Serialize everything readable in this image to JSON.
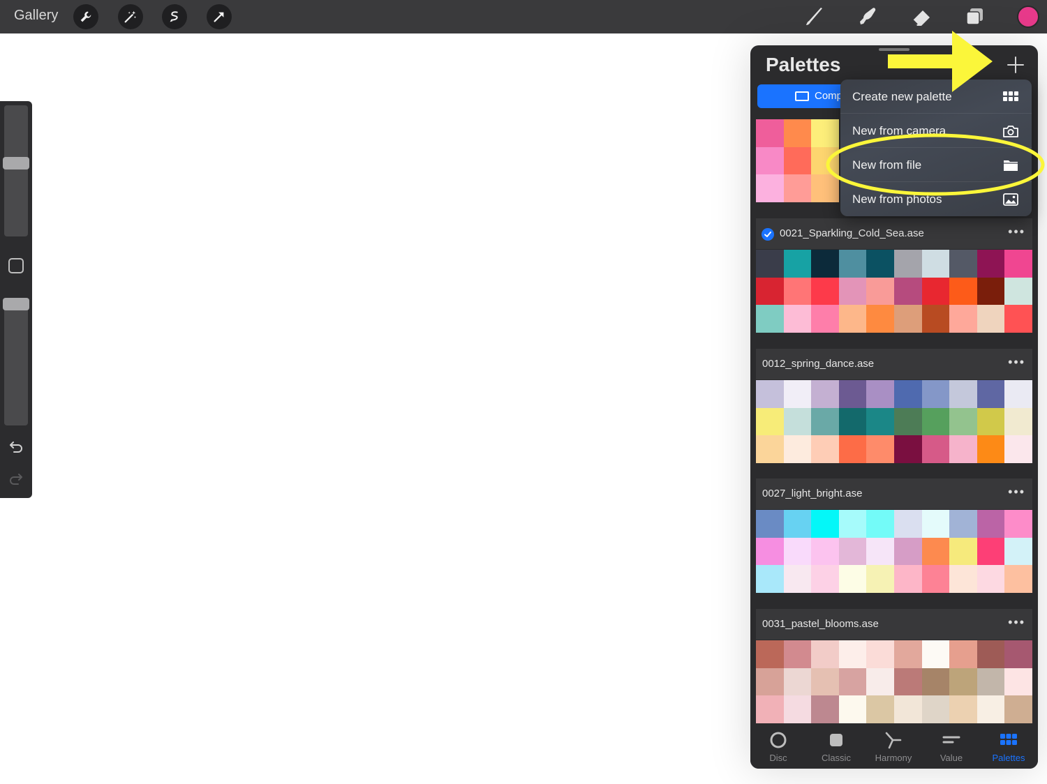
{
  "topbar": {
    "gallery_label": "Gallery",
    "left_tools": [
      "wrench-icon",
      "magic-wand-icon",
      "selection-icon",
      "transform-arrow-icon"
    ],
    "right_tools": [
      "brush-icon",
      "smudge-icon",
      "eraser-icon",
      "layers-icon"
    ],
    "current_color": "#e83a8b"
  },
  "panel": {
    "title": "Palettes",
    "view_tab_label": "Comp",
    "default_palette_colors": [
      "#ef5e9b",
      "#ff8a4c",
      "#fdee7a",
      "#f889c6",
      "#ff6b5a",
      "#fdd56f",
      "#fcb1df",
      "#ff9c97",
      "#ffc07a"
    ],
    "palettes": [
      {
        "name": "0021_Sparkling_Cold_Sea.ase",
        "selected": true,
        "colors": [
          "#3a3d4a",
          "#17a2a4",
          "#0c2a3a",
          "#4f8fa0",
          "#0b5162",
          "#a4a4ab",
          "#cfdde3",
          "#545966",
          "#8e1454",
          "#f04691",
          "#d82431",
          "#ff7576",
          "#fd3a4a",
          "#e394b8",
          "#f99b98",
          "#b64b7e",
          "#e82730",
          "#fd5b19",
          "#7a1e0b",
          "#cfe5df",
          "#7fccc2",
          "#fdbcd6",
          "#fe7eaa",
          "#fdb78a",
          "#fe8a40",
          "#dd9e7a",
          "#b84b22",
          "#fea89a",
          "#efd4be",
          "#ff5254"
        ]
      },
      {
        "name": "0012_spring_dance.ase",
        "selected": false,
        "colors": [
          "#c5c0db",
          "#f1eef7",
          "#c4b0d2",
          "#6c5a92",
          "#a98fc4",
          "#4f6aaf",
          "#8497c8",
          "#c4c8db",
          "#5f67a3",
          "#eaeaf3",
          "#f7ec78",
          "#c5dfdb",
          "#6aa9a7",
          "#13696b",
          "#1b8787",
          "#4d7c56",
          "#56a05d",
          "#93c38e",
          "#d1c94a",
          "#f1ead0",
          "#fbd59a",
          "#fdebde",
          "#fecdb6",
          "#fd6c47",
          "#fe8b6a",
          "#7a0f40",
          "#d65a88",
          "#f6b3cb",
          "#fd8a16",
          "#fbe7ec"
        ]
      },
      {
        "name": "0027_light_bright.ase",
        "selected": false,
        "colors": [
          "#6a8bc4",
          "#67d2f2",
          "#04f7f8",
          "#a6fbfb",
          "#73fbf8",
          "#dadff0",
          "#e4fbfb",
          "#a1b3d6",
          "#bb64a6",
          "#fd8cc9",
          "#f68ee1",
          "#f9dafb",
          "#fcc3ef",
          "#e3b7d8",
          "#f6e5f8",
          "#d69dc6",
          "#fd8a4f",
          "#f6ea7c",
          "#fd3f76",
          "#d3f2f8",
          "#a9e8fa",
          "#f8e8f0",
          "#fdd1e6",
          "#fdfde6",
          "#f6f2b4",
          "#fdb6c8",
          "#fd8295",
          "#fde5d8",
          "#fdd9e2",
          "#fdc0a0"
        ]
      },
      {
        "name": "0031_pastel_blooms.ase",
        "selected": false,
        "colors": [
          "#bb6859",
          "#d28a8f",
          "#f2ccc8",
          "#fdeeea",
          "#fbdcd8",
          "#e2a89c",
          "#fdfaf5",
          "#e69f8e",
          "#9e5b56",
          "#a65870",
          "#d7a298",
          "#ecd7d3",
          "#e5c0b2",
          "#d7a3a1",
          "#f8ecea",
          "#bb7a78",
          "#a68468",
          "#bda47a",
          "#c2b6aa",
          "#fde4e4",
          "#f1b1b7",
          "#f5dbe1",
          "#bd8890",
          "#fdf9ee",
          "#dbc7a4",
          "#f2e6d8",
          "#dfd5c8",
          "#ecd1b1",
          "#f8efe4",
          "#cfae92"
        ]
      }
    ],
    "bottom_tabs": [
      {
        "label": "Disc",
        "icon": "disc-icon"
      },
      {
        "label": "Classic",
        "icon": "classic-square-icon"
      },
      {
        "label": "Harmony",
        "icon": "harmony-icon"
      },
      {
        "label": "Value",
        "icon": "value-sliders-icon"
      },
      {
        "label": "Palettes",
        "icon": "palettes-grid-icon",
        "active": true
      }
    ]
  },
  "menu": {
    "items": [
      {
        "label": "Create new palette",
        "icon": "grid-icon"
      },
      {
        "label": "New from camera",
        "icon": "camera-icon"
      },
      {
        "label": "New from file",
        "icon": "folder-icon"
      },
      {
        "label": "New from photos",
        "icon": "photo-icon"
      }
    ]
  },
  "colors": {
    "accent": "#1a73ff",
    "annotation": "#fbf63a"
  }
}
